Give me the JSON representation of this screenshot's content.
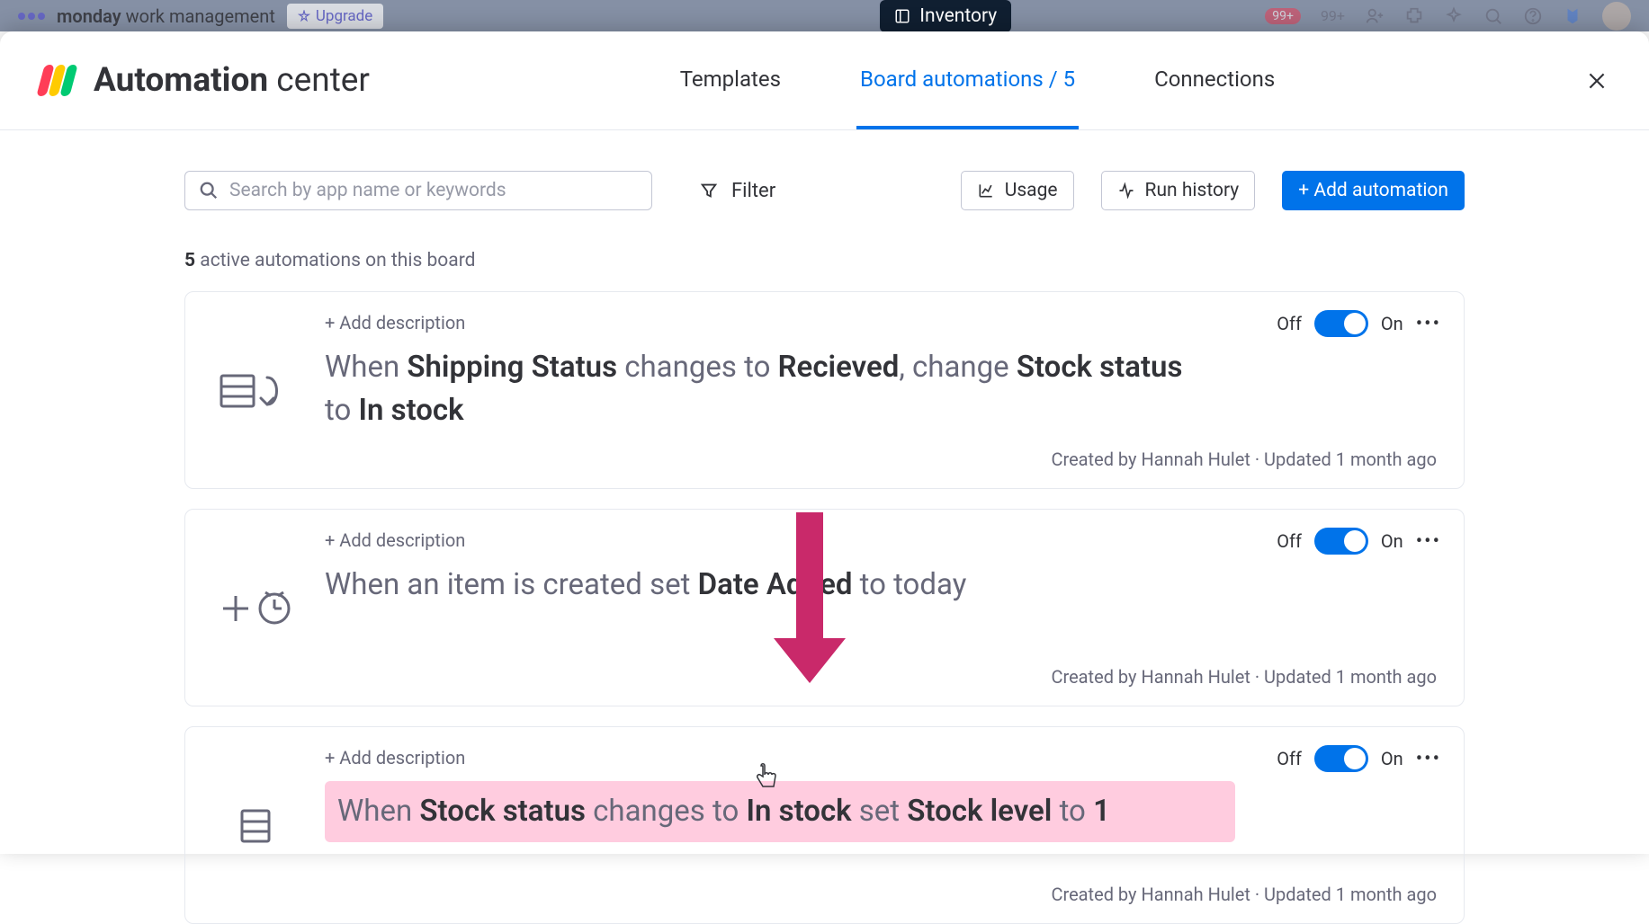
{
  "backdrop": {
    "product": "monday",
    "product_suffix": "work management",
    "upgrade": "Upgrade",
    "tab": "Inventory",
    "badge_red": "99+",
    "badge_grey": "99+"
  },
  "header": {
    "title_bold": "Automation",
    "title_light": " center",
    "tabs": {
      "templates": "Templates",
      "board": "Board automations / 5",
      "connections": "Connections"
    }
  },
  "toolbar": {
    "search_placeholder": "Search by app name or keywords",
    "filter": "Filter",
    "usage": "Usage",
    "run_history": "Run history",
    "add": "+ Add automation"
  },
  "counter": {
    "count": "5",
    "text": " active automations on this board"
  },
  "toggle_labels": {
    "off": "Off",
    "on": "On"
  },
  "add_description": "+ Add description",
  "automations": [
    {
      "recipe_parts": {
        "p1": "When ",
        "b1": "Shipping Status",
        "p2": " changes to ",
        "b2": "Recieved",
        "p3": ", change ",
        "b3": "Stock status",
        "p4": " to ",
        "b4": "In stock"
      },
      "meta": "Created by Hannah Hulet · Updated 1 month ago"
    },
    {
      "recipe_parts": {
        "p1": "When an item is created set ",
        "b1": "Date Added",
        "p2": " to today"
      },
      "meta": "Created by Hannah Hulet · Updated 1 month ago"
    },
    {
      "recipe_parts": {
        "p1": "When ",
        "b1": "Stock status",
        "p2": " changes to ",
        "b2": "In stock",
        "p3": " set ",
        "b3": "Stock level",
        "p4": " to ",
        "b4": "1"
      },
      "meta": "Created by Hannah Hulet · Updated 1 month ago"
    }
  ]
}
